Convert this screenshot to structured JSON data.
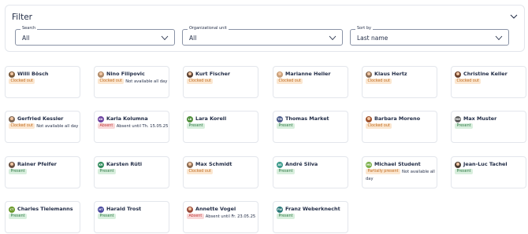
{
  "filter": {
    "title": "Filter",
    "search": {
      "label": "Search",
      "value": "All"
    },
    "org_unit": {
      "label": "Organizational unit",
      "value": "All"
    },
    "sort_by": {
      "label": "Sort by",
      "value": "Last name"
    }
  },
  "colors": {
    "present_bg": "#d9efde",
    "present_fg": "#2e7a45",
    "clocked_bg": "#fbe7d1",
    "clocked_fg": "#c06a1e",
    "absent_bg": "#f8d9d9",
    "absent_fg": "#c03b3b"
  },
  "employees": [
    {
      "name": "Willi Bösch",
      "badge": "Clocked out",
      "status": "clocked",
      "note": "",
      "avatar": "photo",
      "avatar_color": "#7a5a3a"
    },
    {
      "name": "Nino Filipovic",
      "badge": "Clocked out",
      "status": "clocked",
      "note": "Not available all day",
      "avatar": "photo",
      "avatar_color": "#b08a68"
    },
    {
      "name": "Kurt Fischer",
      "badge": "Clocked out",
      "status": "clocked",
      "note": "",
      "avatar": "photo",
      "avatar_color": "#5a4030"
    },
    {
      "name": "Marianne Heller",
      "badge": "Clocked out",
      "status": "clocked",
      "note": "",
      "avatar": "photo",
      "avatar_color": "#c9a07a"
    },
    {
      "name": "Klaus Hertz",
      "badge": "Clocked out",
      "status": "clocked",
      "note": "",
      "avatar": "photo",
      "avatar_color": "#8c6d55"
    },
    {
      "name": "Christine Keller",
      "badge": "Clocked out",
      "status": "clocked",
      "note": "",
      "avatar": "photo",
      "avatar_color": "#6b3f2a"
    },
    {
      "name": "Gerfried Kessler",
      "badge": "Clocked out",
      "status": "clocked",
      "note": "Not available all day",
      "avatar": "photo",
      "avatar_color": "#7d6654"
    },
    {
      "name": "Karla Kolumna",
      "badge": "Absent",
      "status": "absent",
      "note": "Absent until Th. 15.05.25",
      "avatar": "initials",
      "initials": "KK",
      "avatar_color": "#6a3fa0"
    },
    {
      "name": "Lara Korell",
      "badge": "Present",
      "status": "present",
      "note": "",
      "avatar": "initials",
      "initials": "LK",
      "avatar_color": "#4f8f3a"
    },
    {
      "name": "Thomas Market",
      "badge": "Present",
      "status": "present",
      "note": "",
      "avatar": "initials",
      "initials": "TM",
      "avatar_color": "#4a5a8a"
    },
    {
      "name": "Barbara Moreno",
      "badge": "Clocked out",
      "status": "clocked",
      "note": "",
      "avatar": "photo",
      "avatar_color": "#a0522d"
    },
    {
      "name": "Max Muster",
      "badge": "Present",
      "status": "present",
      "note": "",
      "avatar": "initials",
      "initials": "MM",
      "avatar_color": "#5a5a5a"
    },
    {
      "name": "Rainer Pfeifer",
      "badge": "Present",
      "status": "present",
      "note": "",
      "avatar": "photo",
      "avatar_color": "#6b5040"
    },
    {
      "name": "Karsten Rüti",
      "badge": "Present",
      "status": "present",
      "note": "",
      "avatar": "initials",
      "initials": "KR",
      "avatar_color": "#2e8a5a"
    },
    {
      "name": "Max Schmidt",
      "badge": "Clocked out",
      "status": "clocked",
      "note": "",
      "avatar": "photo",
      "avatar_color": "#8a6a50"
    },
    {
      "name": "André Silva",
      "badge": "Present",
      "status": "present",
      "note": "",
      "avatar": "initials",
      "initials": "AS",
      "avatar_color": "#3a9a8a"
    },
    {
      "name": "Michael Student",
      "badge": "Partially present",
      "status": "partial",
      "note": "Not available all day",
      "avatar": "initials",
      "initials": "MS",
      "avatar_color": "#7ab04a"
    },
    {
      "name": "Jean-Luc Tachel",
      "badge": "Present",
      "status": "present",
      "note": "",
      "avatar": "photo",
      "avatar_color": "#4a3a30"
    },
    {
      "name": "Charles Tielemanns",
      "badge": "Present",
      "status": "present",
      "note": "",
      "avatar": "initials",
      "initials": "CT",
      "avatar_color": "#6a9a2a"
    },
    {
      "name": "Harald Trost",
      "badge": "Present",
      "status": "present",
      "note": "",
      "avatar": "initials",
      "initials": "HT",
      "avatar_color": "#4a4aa0"
    },
    {
      "name": "Annette Vogel",
      "badge": "Absent",
      "status": "absent",
      "note": "Absent until Fr. 23.05.25",
      "avatar": "photo",
      "avatar_color": "#9a4a3a"
    },
    {
      "name": "Franz Weberknecht",
      "badge": "Present",
      "status": "present",
      "note": "",
      "avatar": "initials",
      "initials": "FW",
      "avatar_color": "#2a7a7a"
    }
  ]
}
